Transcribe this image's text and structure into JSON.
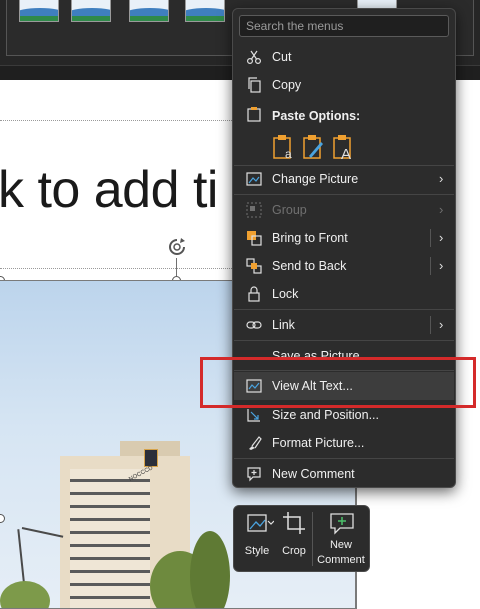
{
  "ribbon": {
    "thumbnail_icons": [
      "picture-style-thumb",
      "picture-style-thumb",
      "picture-style-thumb",
      "picture-style-thumb",
      "picture-style-thumb"
    ]
  },
  "slide": {
    "title_placeholder": "k to add ti",
    "picture_sign_text": "NOCCCD"
  },
  "context_menu": {
    "search_placeholder": "Search the menus",
    "cut": "Cut",
    "copy": "Copy",
    "paste_options": "Paste Options:",
    "change_picture": "Change Picture",
    "group": "Group",
    "bring_to_front": "Bring to Front",
    "send_to_back": "Send to Back",
    "lock": "Lock",
    "link": "Link",
    "save_as_picture": "Save as Picture...",
    "view_alt_text": "View Alt Text...",
    "size_and_position": "Size and Position...",
    "format_picture": "Format Picture...",
    "new_comment": "New Comment"
  },
  "mini_toolbar": {
    "style": "Style",
    "crop": "Crop",
    "new_comment_line1": "New",
    "new_comment_line2": "Comment"
  },
  "colors": {
    "menu_bg": "#2c2c2c",
    "highlight": "#3d3d3d",
    "accent_orange": "#f0a030",
    "annotation_red": "#d42a2a"
  }
}
